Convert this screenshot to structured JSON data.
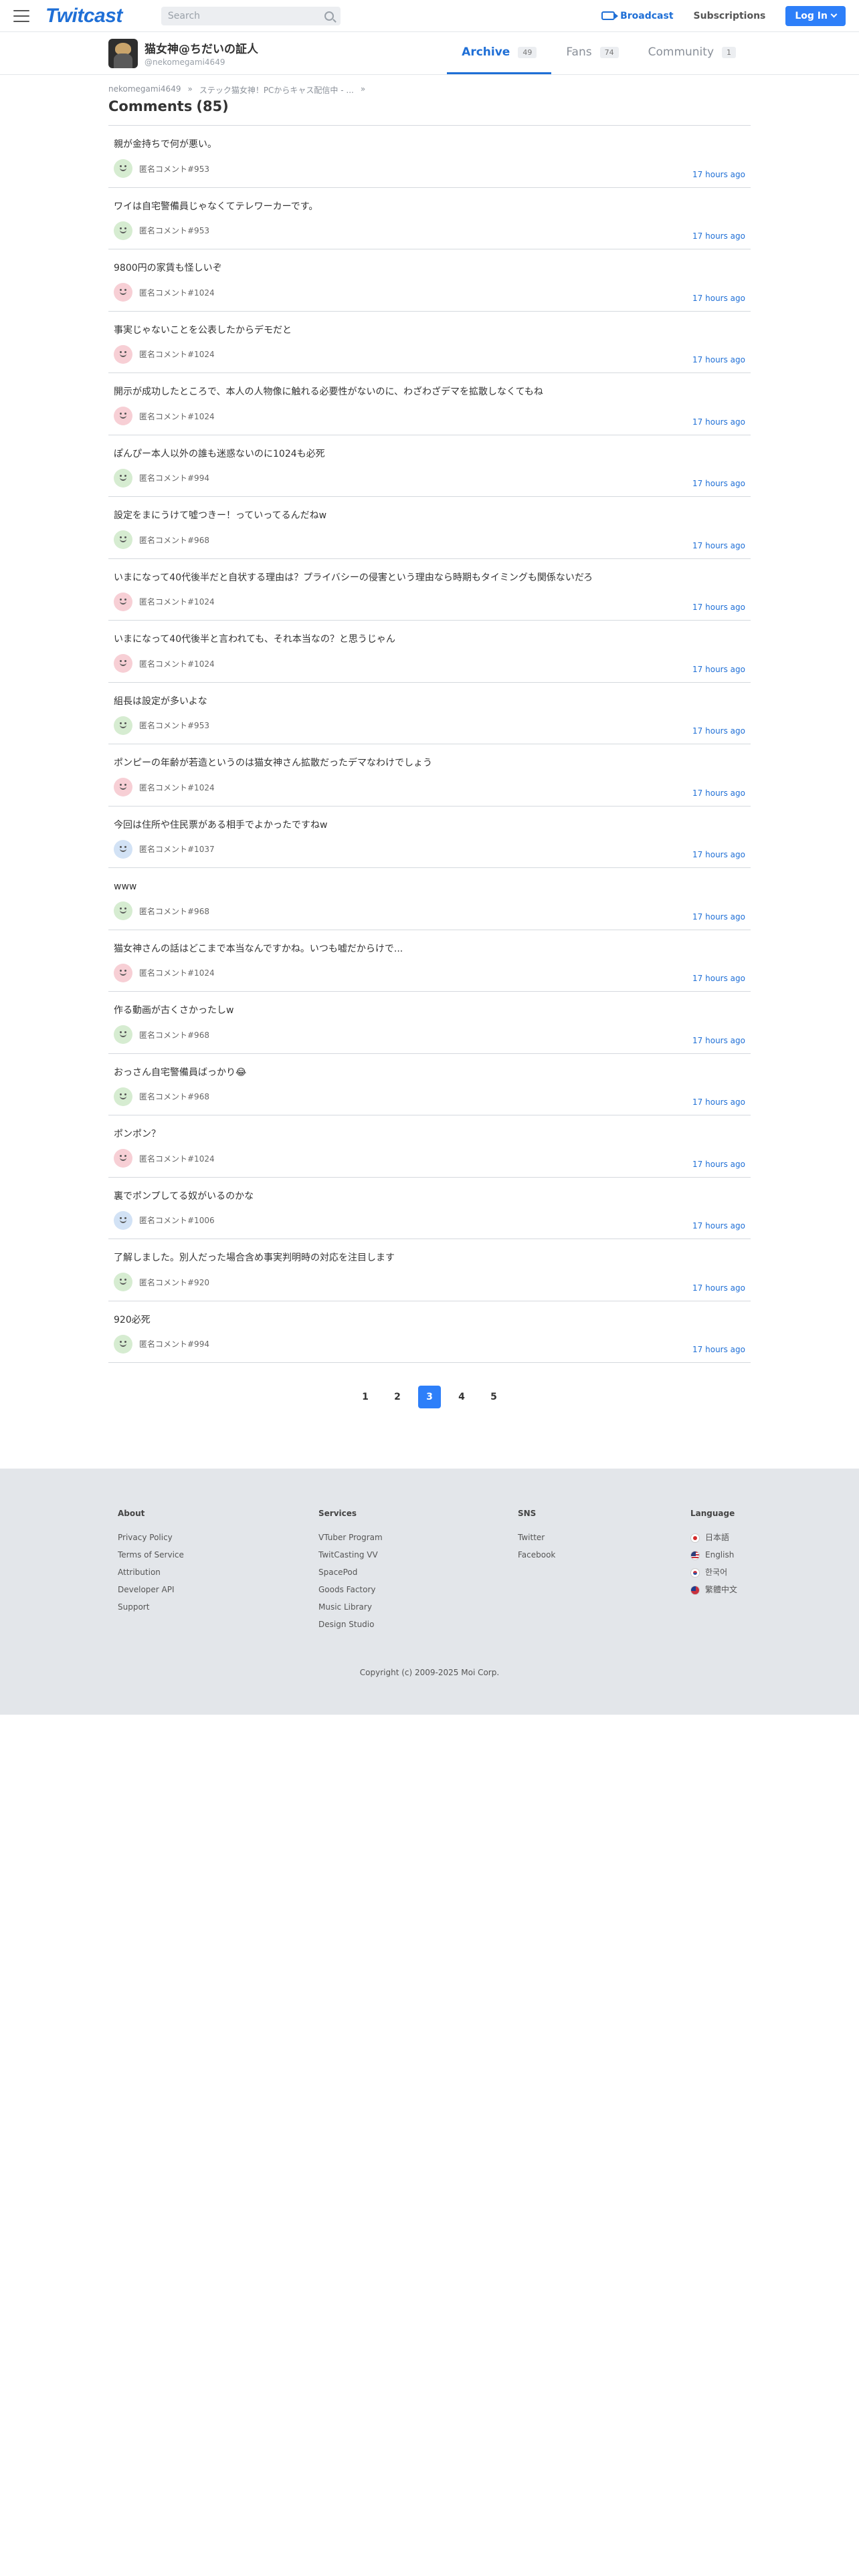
{
  "header": {
    "logo": "Twitcast",
    "search_placeholder": "Search",
    "broadcast_label": "Broadcast",
    "subscriptions_label": "Subscriptions",
    "login_label": "Log In"
  },
  "profile": {
    "name": "猫女神@ちだいの証人",
    "id": "@nekomegami4649",
    "tabs": [
      {
        "label": "Archive",
        "count": "49"
      },
      {
        "label": "Fans",
        "count": "74"
      },
      {
        "label": "Community",
        "count": "1"
      }
    ]
  },
  "breadcrumb": {
    "user": "nekomegami4649",
    "sep": "»",
    "live": "ステック猫女神！PCからキャス配信中 - ...",
    "sep2": "»"
  },
  "page_title": {
    "label": "Comments",
    "count": "(85)"
  },
  "comments": [
    {
      "text": "親が金持ちで何が悪い。",
      "author": "匿名コメント#953",
      "time": "17 hours ago",
      "avatar": "green"
    },
    {
      "text": "ワイは自宅警備員じゃなくてテレワーカーです。",
      "author": "匿名コメント#953",
      "time": "17 hours ago",
      "avatar": "green"
    },
    {
      "text": "9800円の家賃も怪しいぞ",
      "author": "匿名コメント#1024",
      "time": "17 hours ago",
      "avatar": "pink"
    },
    {
      "text": "事実じゃないことを公表したからデモだと",
      "author": "匿名コメント#1024",
      "time": "17 hours ago",
      "avatar": "pink"
    },
    {
      "text": "開示が成功したところで、本人の人物像に触れる必要性がないのに、わざわざデマを拡散しなくてもね",
      "author": "匿名コメント#1024",
      "time": "17 hours ago",
      "avatar": "pink"
    },
    {
      "text": "ぽんぴー本人以外の誰も迷惑ないのに1024も必死",
      "author": "匿名コメント#994",
      "time": "17 hours ago",
      "avatar": "green"
    },
    {
      "text": "設定をまにうけて噓つきー！っていってるんだねw",
      "author": "匿名コメント#968",
      "time": "17 hours ago",
      "avatar": "green"
    },
    {
      "text": "いまになって40代後半だと自状する理由は？プライバシーの侵害という理由なら時期もタイミングも関係ないだろ",
      "author": "匿名コメント#1024",
      "time": "17 hours ago",
      "avatar": "pink"
    },
    {
      "text": "いまになって40代後半と言われても、それ本当なの？と思うじゃん",
      "author": "匿名コメント#1024",
      "time": "17 hours ago",
      "avatar": "pink"
    },
    {
      "text": "組長は設定が多いよな",
      "author": "匿名コメント#953",
      "time": "17 hours ago",
      "avatar": "green"
    },
    {
      "text": "ポンピーの年齢が若造というのは猫女神さん拡散だったデマなわけでしょう",
      "author": "匿名コメント#1024",
      "time": "17 hours ago",
      "avatar": "pink"
    },
    {
      "text": "今回は住所や住民票がある相手でよかったですねw",
      "author": "匿名コメント#1037",
      "time": "17 hours ago",
      "avatar": "blue"
    },
    {
      "text": "www",
      "author": "匿名コメント#968",
      "time": "17 hours ago",
      "avatar": "green"
    },
    {
      "text": "猫女神さんの話はどこまで本当なんですかね。いつも嘘だからけで...",
      "author": "匿名コメント#1024",
      "time": "17 hours ago",
      "avatar": "pink"
    },
    {
      "text": "作る動画が古くさかったしw",
      "author": "匿名コメント#968",
      "time": "17 hours ago",
      "avatar": "green"
    },
    {
      "text": "おっさん自宅警備員ばっかり😂",
      "author": "匿名コメント#968",
      "time": "17 hours ago",
      "avatar": "green"
    },
    {
      "text": "ポンポン？",
      "author": "匿名コメント#1024",
      "time": "17 hours ago",
      "avatar": "pink"
    },
    {
      "text": "裏でポンプしてる奴がいるのかな",
      "author": "匿名コメント#1006",
      "time": "17 hours ago",
      "avatar": "blue"
    },
    {
      "text": "了解しました。別人だった場合含め事実判明時の対応を注目します",
      "author": "匿名コメント#920",
      "time": "17 hours ago",
      "avatar": "green"
    },
    {
      "text": "920必死",
      "author": "匿名コメント#994",
      "time": "17 hours ago",
      "avatar": "green"
    }
  ],
  "pagination": {
    "pages": [
      "1",
      "2",
      "3",
      "4",
      "5"
    ],
    "current": "3"
  },
  "footer": {
    "about": {
      "title": "About",
      "links": [
        "Privacy Policy",
        "Terms of Service",
        "Attribution",
        "Developer API",
        "Support"
      ]
    },
    "services": {
      "title": "Services",
      "links": [
        "VTuber Program",
        "TwitCasting VV",
        "SpacePod",
        "Goods Factory",
        "Music Library",
        "Design Studio"
      ]
    },
    "sns": {
      "title": "SNS",
      "links": [
        "Twitter",
        "Facebook"
      ]
    },
    "language": {
      "title": "Language",
      "links": [
        "日本語",
        "English",
        "한국어",
        "繁體中文"
      ]
    },
    "copyright": "Copyright (c) 2009-2025 Moi Corp."
  }
}
